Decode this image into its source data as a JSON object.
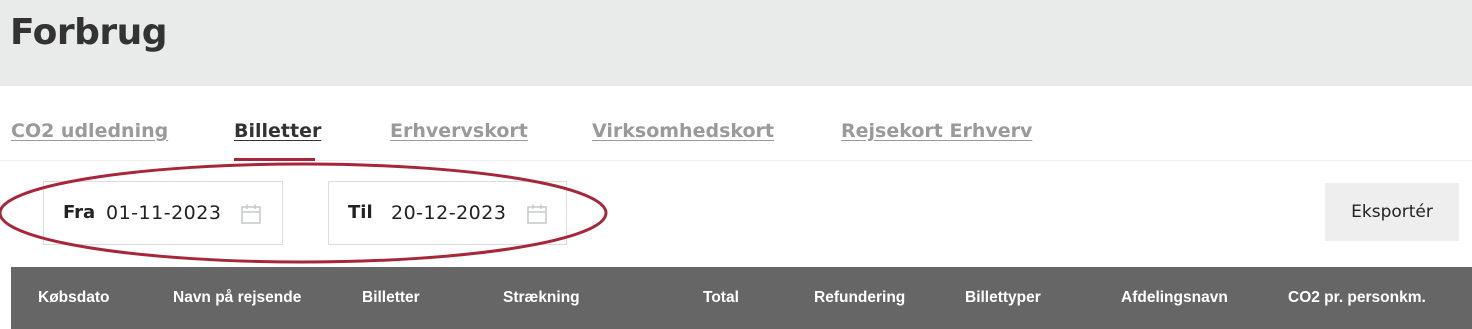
{
  "page": {
    "title": "Forbrug"
  },
  "tabs": [
    {
      "label": "CO2 udledning",
      "active": false
    },
    {
      "label": "Billetter",
      "active": true
    },
    {
      "label": "Erhvervskort",
      "active": false
    },
    {
      "label": "Virksomhedskort",
      "active": false
    },
    {
      "label": "Rejsekort Erhverv",
      "active": false
    }
  ],
  "filters": {
    "from": {
      "label": "Fra",
      "value": "01-11-2023",
      "icon": "calendar-icon"
    },
    "to": {
      "label": "Til",
      "value": "20-12-2023",
      "icon": "calendar-icon"
    }
  },
  "export_label": "Eksportér",
  "table": {
    "columns": [
      "Købsdato",
      "Navn på rejsende",
      "Billetter",
      "Strækning",
      "Total",
      "Refundering",
      "Billettyper",
      "Afdelingsnavn",
      "CO2 pr. personkm."
    ]
  },
  "colors": {
    "accent": "#a8263a",
    "header_bg": "#e8ebea",
    "table_header_bg": "#666666"
  }
}
